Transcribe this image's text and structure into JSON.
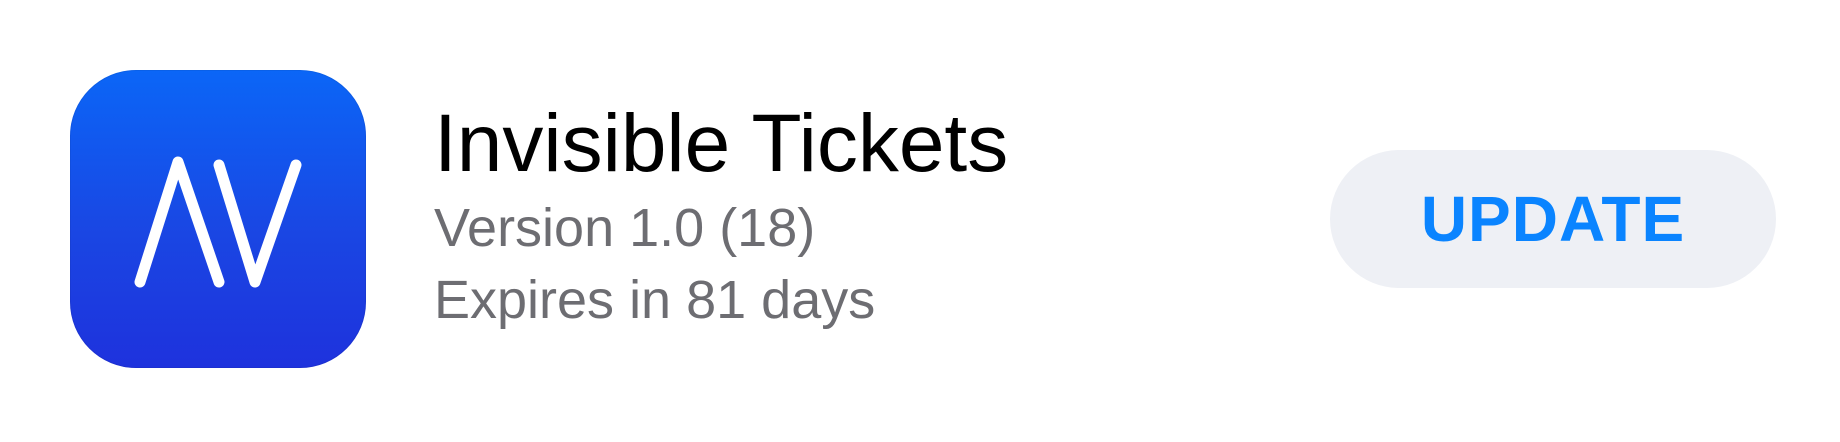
{
  "app": {
    "name": "Invisible Tickets",
    "version": "Version 1.0 (18)",
    "expiry": "Expires in 81 days",
    "icon": "app-logo-AV",
    "icon_gradient": [
      "#0b66f7",
      "#1e32dd"
    ],
    "icon_glyph_color": "#ffffff"
  },
  "actions": {
    "update_label": "UPDATE",
    "update_color": "#0a84ff",
    "update_background": "#eef0f5"
  }
}
